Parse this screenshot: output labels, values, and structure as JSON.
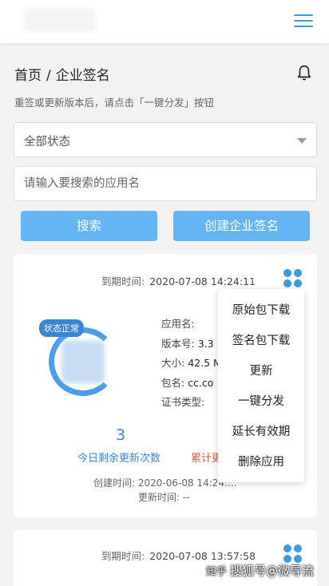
{
  "header": {
    "logo_icon": "app-logo-blurred",
    "menu_icon": "hamburger-menu-icon"
  },
  "breadcrumb": {
    "home": "首页",
    "separator": "/",
    "current": "企业签名"
  },
  "bell_icon": "bell-icon",
  "hint": "重签或更新版本后，请点击「一键分发」按钮",
  "filter": {
    "selected": "全部状态"
  },
  "search": {
    "placeholder": "请输入要搜索的应用名"
  },
  "buttons": {
    "search": "搜索",
    "create": "创建企业签名"
  },
  "cards": [
    {
      "expire_label": "到期时间:",
      "expire_value": "2020-07-08 14:24:11",
      "status": "状态正常",
      "fields": [
        {
          "label": "应用名:",
          "value": ""
        },
        {
          "label": "版本号:",
          "value": "3.3"
        },
        {
          "label": "大小:",
          "value": "42.5 M"
        },
        {
          "label": "包名:",
          "value": "cc.co"
        },
        {
          "label": "证书类型:",
          "value": ""
        }
      ],
      "remaining_count": "3",
      "remaining_label": "今日剩余更新次数",
      "total_label": "累计更",
      "created_label": "创建时间:",
      "created_value": "2020-06-08 14:24:...",
      "updated_label": "更新时间:",
      "updated_value": "--"
    },
    {
      "expire_label": "到期时间:",
      "expire_value": "2020-07-08 13:57:58"
    }
  ],
  "menu": {
    "items": [
      "原始包下载",
      "签名包下载",
      "更新",
      "一键分发",
      "延长有效期",
      "删除应用"
    ]
  },
  "watermark": {
    "zhihu": "知乎",
    "text": "搜狐号@微导流"
  },
  "colors": {
    "accent": "#3a9be3",
    "button": "#64b5f6",
    "warn": "#e05a3a"
  }
}
